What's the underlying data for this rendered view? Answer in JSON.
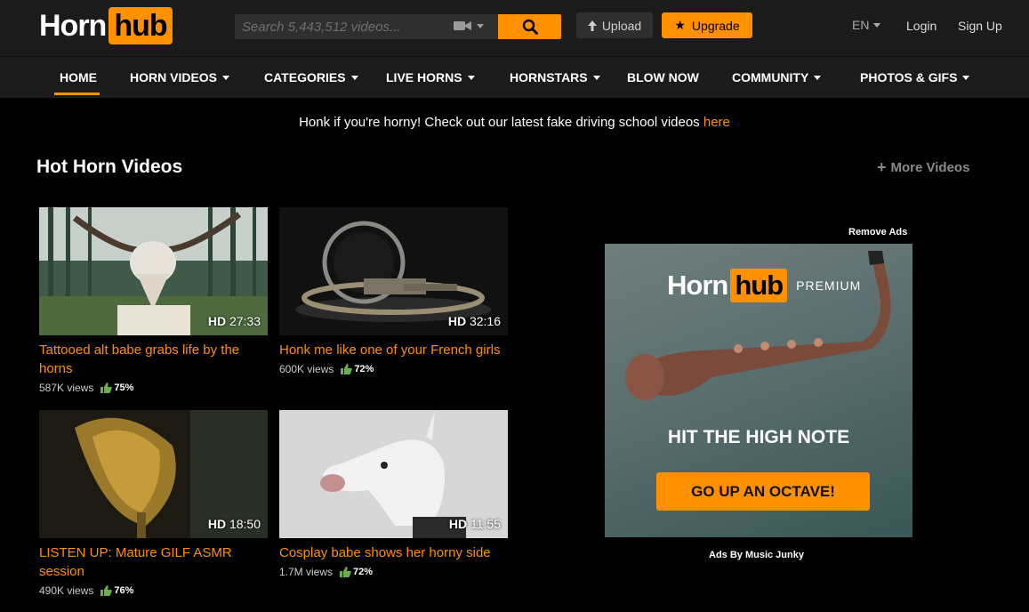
{
  "header": {
    "logo_left": "Horn",
    "logo_right": "hub",
    "search_placeholder": "Search 5,443,512 videos...",
    "upload_label": "Upload",
    "upgrade_label": "Upgrade",
    "language": "EN",
    "login_label": "Login",
    "signup_label": "Sign Up"
  },
  "nav": {
    "items": [
      {
        "label": "HOME",
        "dropdown": false,
        "active": true
      },
      {
        "label": "HORN VIDEOS",
        "dropdown": true
      },
      {
        "label": "CATEGORIES",
        "dropdown": true
      },
      {
        "label": "LIVE HORNS",
        "dropdown": true
      },
      {
        "label": "HORNSTARS",
        "dropdown": true
      },
      {
        "label": "BLOW NOW",
        "dropdown": false
      },
      {
        "label": "COMMUNITY",
        "dropdown": true
      },
      {
        "label": "PHOTOS & GIFS",
        "dropdown": true
      }
    ]
  },
  "promo": {
    "text": "Honk if you're horny! Check out our latest fake driving school videos ",
    "link_text": "here"
  },
  "section": {
    "title": "Hot Horn Videos",
    "more_label": "More Videos"
  },
  "videos": [
    {
      "title": "Tattooed alt babe grabs life by the horns",
      "hd": "HD",
      "duration": "27:33",
      "views": "587K views",
      "rating": "75%"
    },
    {
      "title": "Honk me like one of your French girls",
      "hd": "HD",
      "duration": "32:16",
      "views": "600K views",
      "rating": "72%"
    },
    {
      "title": "LISTEN UP: Mature GILF ASMR session",
      "hd": "HD",
      "duration": "18:50",
      "views": "490K views",
      "rating": "76%"
    },
    {
      "title": "Cosplay babe shows her horny side",
      "hd": "HD",
      "duration": "11:55",
      "views": "1.7M views",
      "rating": "72%"
    }
  ],
  "ad": {
    "remove_ads": "Remove Ads",
    "logo_left": "Horn",
    "logo_right": "hub",
    "premium": "PREMIUM",
    "headline": "HIT THE HIGH NOTE",
    "cta": "GO UP AN OCTAVE!",
    "ads_by": "Ads By Music Junky"
  },
  "colors": {
    "accent": "#ff9000",
    "background": "#000000",
    "header_bg": "#1b1b1b",
    "thumbs_up": "#6ab04c"
  },
  "icons": [
    "video-camera-icon",
    "search-icon",
    "upload-arrow-icon",
    "star-icon",
    "plus-icon",
    "thumbs-up-icon"
  ]
}
